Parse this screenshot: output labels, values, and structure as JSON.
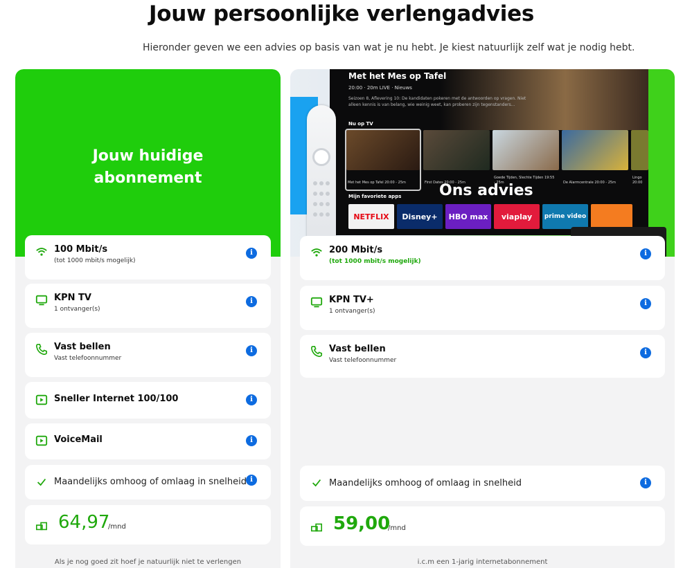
{
  "page": {
    "title": "Jouw persoonlijke verlengadvies",
    "subtitle": "Hieronder geven we een advies op basis van wat je nu hebt. Je kiest natuurlijk zelf wat je nodig hebt."
  },
  "current": {
    "heading": "Jouw huidige abonnement",
    "items": [
      {
        "icon": "wifi-icon",
        "title": "100 Mbit/s",
        "sub": "(tot 1000 mbit/s mogelijk)"
      },
      {
        "icon": "tv-icon",
        "title": "KPN TV",
        "sub": "1 ontvanger(s)"
      },
      {
        "icon": "phone-icon",
        "title": "Vast bellen",
        "sub": "Vast telefoonnummer"
      },
      {
        "icon": "play-icon",
        "title": "Sneller Internet 100/100",
        "sub": ""
      },
      {
        "icon": "play-icon",
        "title": "VoiceMail",
        "sub": ""
      }
    ],
    "flex_label": "Maandelijks omhoog of omlaag in snelheid",
    "price": "64,97",
    "per": "/mnd",
    "footnote": "Als je nog goed zit hoef je natuurlijk niet te verlengen"
  },
  "advice": {
    "heading": "Ons advies",
    "items": [
      {
        "icon": "wifi-icon",
        "title": "200 Mbit/s",
        "sub": "(tot 1000 mbit/s mogelijk)"
      },
      {
        "icon": "tv-icon",
        "title": "KPN TV+",
        "sub": "1 ontvanger(s)"
      },
      {
        "icon": "phone-icon",
        "title": "Vast bellen",
        "sub": "Vast telefoonnummer"
      }
    ],
    "flex_label": "Maandelijks omhoog of omlaag in snelheid",
    "price": "59,00",
    "per": "/mnd",
    "footnote": "i.c.m een 1-jarig internetabonnement"
  },
  "tv_screen": {
    "show_title": "Met het Mes op Tafel",
    "show_meta": "20:00 · 20m LIVE · Nieuws",
    "show_desc": "Seizoen 8, Aflevering 10: De kandidaten pokeren met de antwoorden op vragen. Niet alleen kennis is van belang, wie weinig weet, kan proberen zijn tegenstanders...",
    "row_label": "Nu op TV",
    "thumbs": [
      {
        "cap": "Met het Mes op Tafel 20:00 - 25m"
      },
      {
        "cap": "First Dates 20:00 - 25m"
      },
      {
        "cap": "Goede Tijden, Slechte Tijden 19:55 - 25m"
      },
      {
        "cap": "De Alarmcentrale 20:00 - 25m"
      },
      {
        "cap": "Lingo 20:00"
      }
    ],
    "apps_label": "Mijn favoriete apps",
    "apps": [
      "NETFLIX",
      "Disney+",
      "HBO max",
      "viaplay",
      "prime video"
    ]
  },
  "colors": {
    "accent": "#1fcd0c",
    "price": "#1fa80c",
    "info": "#0d6be0",
    "icon": "#1fa80c"
  }
}
